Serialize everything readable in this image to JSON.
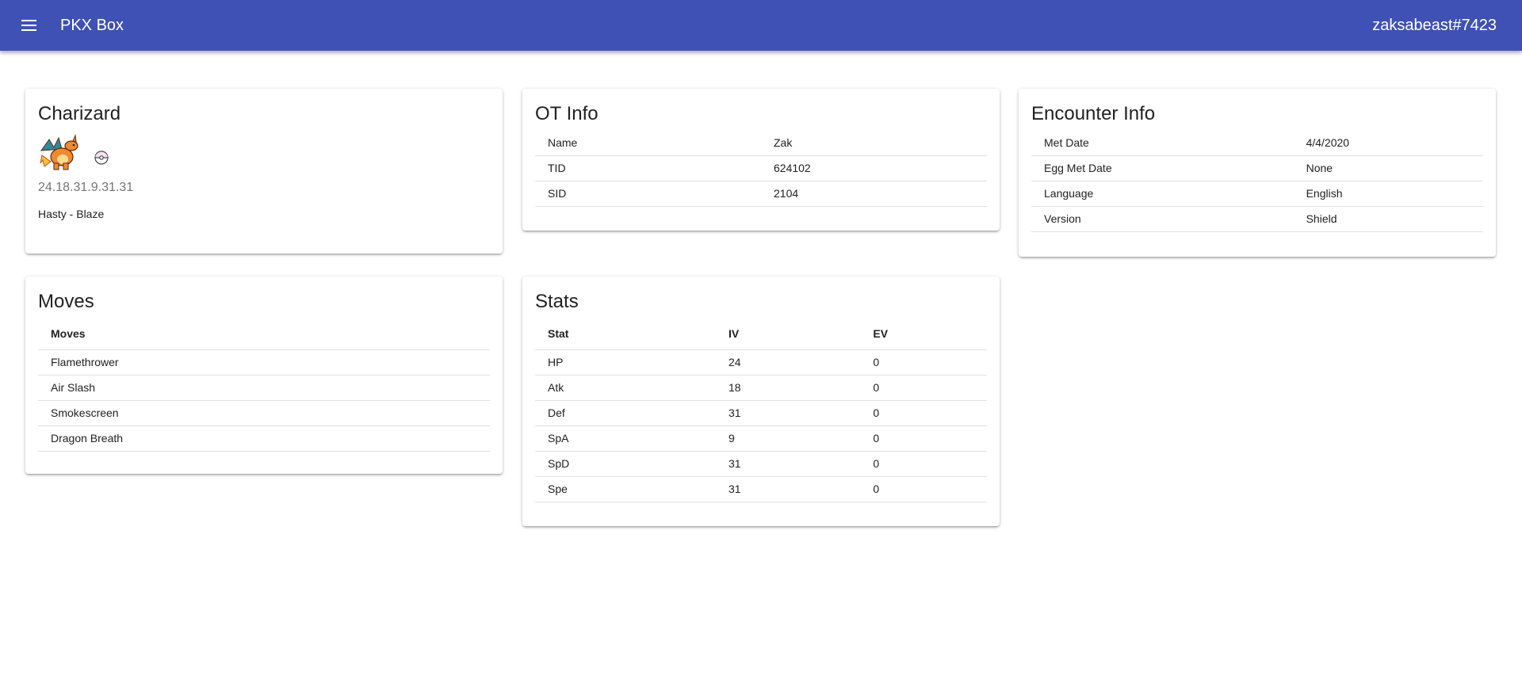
{
  "appbar": {
    "title": "PKX Box",
    "user": "zaksabeast#7423",
    "color": "#3f51b5"
  },
  "pokemon": {
    "title": "Charizard",
    "sprite_icon": "charizard-sprite-icon",
    "ball_icon": "poke-ball-icon",
    "ivs": "24.18.31.9.31.31",
    "nature_ability": "Hasty - Blaze"
  },
  "ot_info": {
    "title": "OT Info",
    "rows": [
      {
        "label": "Name",
        "value": "Zak"
      },
      {
        "label": "TID",
        "value": "624102"
      },
      {
        "label": "SID",
        "value": "2104"
      }
    ]
  },
  "encounter_info": {
    "title": "Encounter Info",
    "rows": [
      {
        "label": "Met Date",
        "value": "4/4/2020"
      },
      {
        "label": "Egg Met Date",
        "value": "None"
      },
      {
        "label": "Language",
        "value": "English"
      },
      {
        "label": "Version",
        "value": "Shield"
      }
    ]
  },
  "moves": {
    "title": "Moves",
    "header": "Moves",
    "items": [
      "Flamethrower",
      "Air Slash",
      "Smokescreen",
      "Dragon Breath"
    ]
  },
  "stats": {
    "title": "Stats",
    "headers": [
      "Stat",
      "IV",
      "EV"
    ],
    "rows": [
      {
        "stat": "HP",
        "iv": "24",
        "ev": "0"
      },
      {
        "stat": "Atk",
        "iv": "18",
        "ev": "0"
      },
      {
        "stat": "Def",
        "iv": "31",
        "ev": "0"
      },
      {
        "stat": "SpA",
        "iv": "9",
        "ev": "0"
      },
      {
        "stat": "SpD",
        "iv": "31",
        "ev": "0"
      },
      {
        "stat": "Spe",
        "iv": "31",
        "ev": "0"
      }
    ]
  }
}
